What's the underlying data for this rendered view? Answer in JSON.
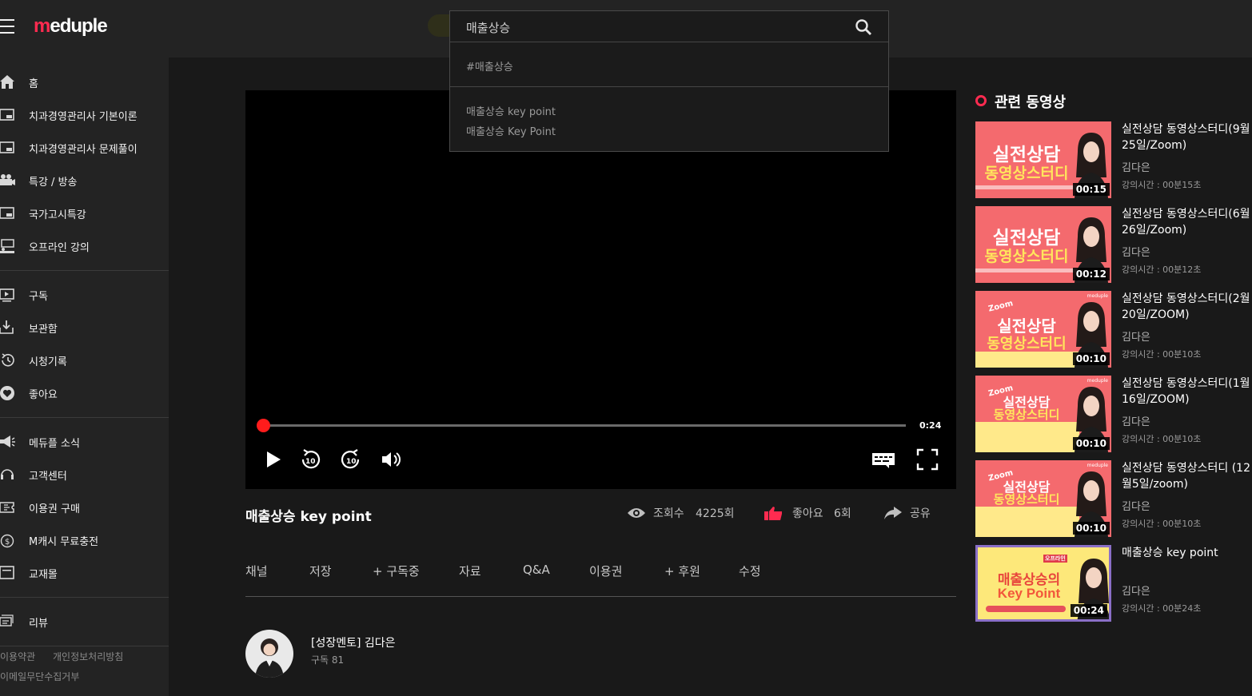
{
  "header": {
    "logo_m": "m",
    "logo_rest": "eduple",
    "search_value": "매출상승"
  },
  "search_dropdown": {
    "tag": "#매출상승",
    "suggestions": [
      "매출상승 key point",
      "매출상승 Key Point"
    ]
  },
  "sidebar": {
    "group1": [
      "홈",
      "치과경영관리사 기본이론",
      "치과경영관리사 문제풀이",
      "특강 / 방송",
      "국가고시특강",
      "오프라인 강의"
    ],
    "group2": [
      "구독",
      "보관함",
      "시청기록",
      "좋아요"
    ],
    "group3": [
      "메듀플 소식",
      "고객센터",
      "이용권 구매",
      "M캐시 무료충전",
      "교재몰"
    ],
    "group4": [
      "리뷰"
    ],
    "footer": [
      "이용약관",
      "개인정보처리방침",
      "이메일무단수집거부"
    ]
  },
  "player": {
    "duration": "0:24",
    "progress": 0.0
  },
  "video": {
    "title": "매출상승 key point",
    "views_label": "조회수",
    "views": "4225회",
    "likes_label": "좋아요",
    "likes": "6회",
    "share_label": "공유"
  },
  "tabs": [
    "채널",
    "저장",
    "+ 구독중",
    "자료",
    "Q&A",
    "이용권",
    "+ 후원",
    "수정"
  ],
  "channel": {
    "name": "[성장멘토] 김다은",
    "subs_label": "구독",
    "subs": "81"
  },
  "related": {
    "heading": "관련 동영상",
    "items": [
      {
        "title": "실전상담 동영상스터디(9월 25일/Zoom)",
        "author": "김다은",
        "duration_label": "강의시간 : 00분15초",
        "thumb_duration": "00:15",
        "thumb_line1": "실전상담",
        "thumb_line2": "동영상스터디"
      },
      {
        "title": "실전상담 동영상스터디(6월 26일/Zoom)",
        "author": "김다은",
        "duration_label": "강의시간 : 00분12초",
        "thumb_duration": "00:12",
        "thumb_line1": "실전상담",
        "thumb_line2": "동영상스터디"
      },
      {
        "title": "실전상담 동영상스터디(2월 20일/ZOOM)",
        "author": "김다은",
        "duration_label": "강의시간 : 00분10초",
        "thumb_duration": "00:10",
        "thumb_line1": "실전상담",
        "thumb_line2": "동영상스터디",
        "thumb_zoom": "Zoom",
        "thumb_brand": "meduple"
      },
      {
        "title": "실전상담 동영상스터디(1월 16일/ZOOM)",
        "author": "김다은",
        "duration_label": "강의시간 : 00분10초",
        "thumb_duration": "00:10",
        "thumb_line1": "실전상담",
        "thumb_line2": "동영상스터디",
        "thumb_zoom": "Zoom",
        "thumb_brand": "meduple"
      },
      {
        "title": "실전상담 동영상스터디 (12월5일/zoom)",
        "author": "김다은",
        "duration_label": "강의시간 : 00분10초",
        "thumb_duration": "00:10",
        "thumb_line1": "실전상담",
        "thumb_line2": "동영상스터디",
        "thumb_zoom": "Zoom",
        "thumb_brand": "meduple"
      },
      {
        "title": "매출상승 key point",
        "author": "김다은",
        "duration_label": "강의시간 : 00분24초",
        "thumb_duration": "00:24",
        "thumb_line1": "매출상승의",
        "thumb_line2": "Key Point",
        "thumb_tag": "오프라인"
      }
    ]
  },
  "colors": {
    "accent": "#ff2b50",
    "background": "#191919",
    "panel": "#232323",
    "progress_knob": "#ff1c1c"
  }
}
